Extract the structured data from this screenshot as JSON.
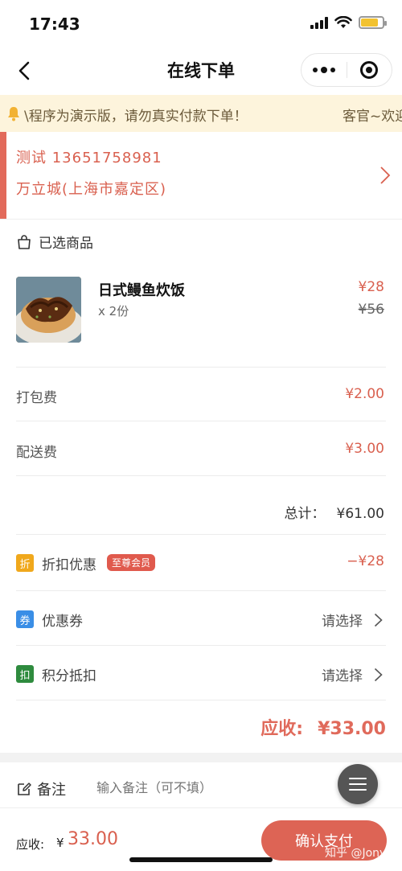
{
  "status": {
    "time": "17:43"
  },
  "nav": {
    "title": "在线下单"
  },
  "notice": {
    "text": "\\程序为演示版，请勿真实付款下单！",
    "text2": "客官~欢迎"
  },
  "address": {
    "contact": "测试 13651758981",
    "location": "万立城(上海市嘉定区)"
  },
  "cart": {
    "title": "已选商品",
    "item": {
      "name": "日式鳗鱼炊饭",
      "qty": "x 2份",
      "price": "¥28",
      "orig_price": "¥56"
    }
  },
  "fees": [
    {
      "label": "打包费",
      "value": "¥2.00"
    },
    {
      "label": "配送费",
      "value": "¥3.00"
    }
  ],
  "total": {
    "label": "总计：",
    "value": "¥61.00"
  },
  "discount": {
    "icon": "折",
    "label": "折扣优惠",
    "badge": "至尊会员",
    "value": "−¥28",
    "color": "#f0a81c"
  },
  "coupon": {
    "icon": "券",
    "label": "优惠券",
    "action": "请选择",
    "color": "#3a8ee6"
  },
  "points": {
    "icon": "扣",
    "label": "积分抵扣",
    "action": "请选择",
    "color": "#2e8b3e"
  },
  "due": {
    "label": "应收:",
    "value": "¥33.00"
  },
  "remark": {
    "label": "备注",
    "placeholder": "输入备注（可不填）"
  },
  "bottom": {
    "label": "应收:",
    "currency": "¥",
    "amount": "33.00",
    "button": "确认支付",
    "watermark": "知乎 @Jony"
  },
  "colors": {
    "accent": "#d9604f",
    "notice_bg": "#fdf4dc"
  }
}
